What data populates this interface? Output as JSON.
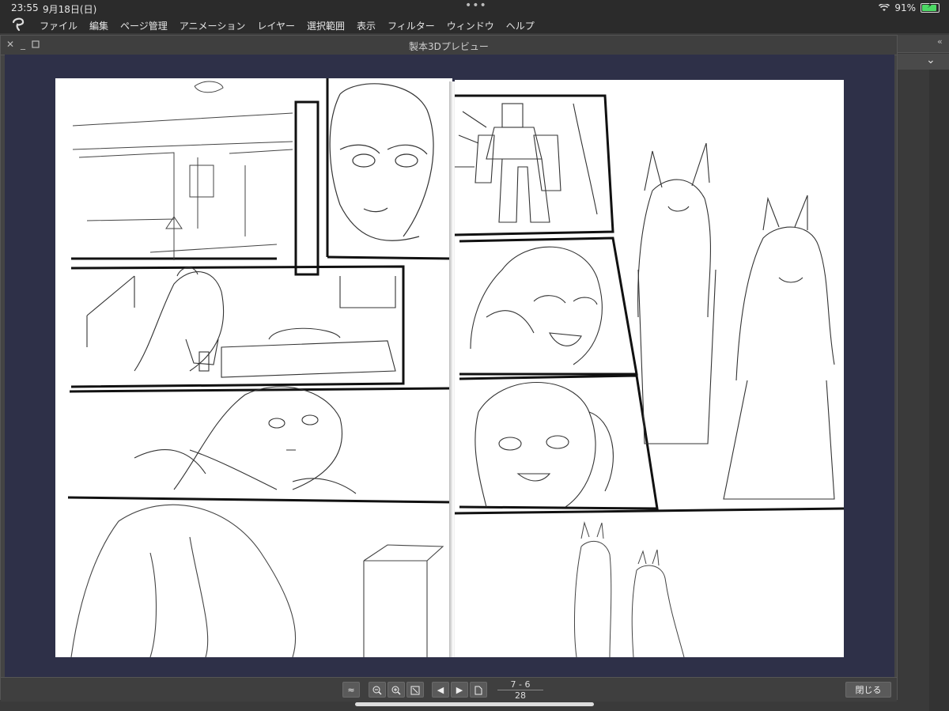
{
  "status": {
    "time": "23:55",
    "date": "9月18日(日)",
    "battery": "91%",
    "battery_level": 0.91
  },
  "menubar": {
    "items": [
      "ファイル",
      "編集",
      "ページ管理",
      "アニメーション",
      "レイヤー",
      "選択範囲",
      "表示",
      "フィルター",
      "ウィンドウ",
      "ヘルプ"
    ]
  },
  "dialog": {
    "title": "製本3Dプレビュー",
    "close_label": "閉じる"
  },
  "pager": {
    "spread": "7 - 6",
    "total": "28"
  },
  "icons": {
    "close": "close-icon",
    "minimize": "minimize-icon",
    "maximize": "maximize-icon",
    "zoom_out": "zoom-out-icon",
    "zoom_in": "zoom-in-icon",
    "fit": "fit-icon",
    "prev": "prev-page-icon",
    "next": "next-page-icon",
    "page": "single-page-icon"
  }
}
